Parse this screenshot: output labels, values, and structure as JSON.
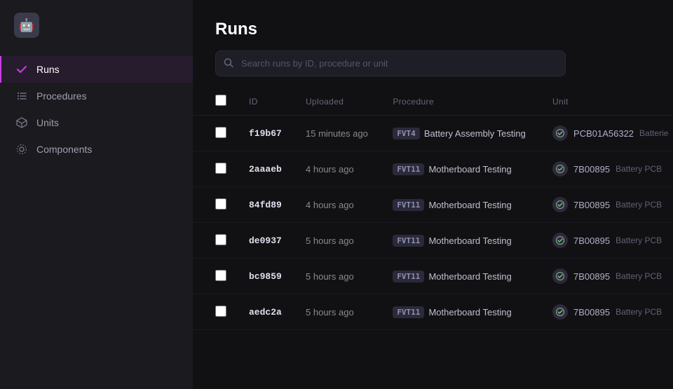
{
  "sidebar": {
    "logo": "🤖",
    "nav_items": [
      {
        "id": "runs",
        "label": "Runs",
        "icon": "check",
        "active": true
      },
      {
        "id": "procedures",
        "label": "Procedures",
        "icon": "list",
        "active": false
      },
      {
        "id": "units",
        "label": "Units",
        "icon": "box",
        "active": false
      },
      {
        "id": "components",
        "label": "Components",
        "icon": "component",
        "active": false
      }
    ]
  },
  "page": {
    "title": "Runs",
    "search_placeholder": "Search runs by ID, procedure or unit"
  },
  "table": {
    "columns": [
      "",
      "ID",
      "Uploaded",
      "Procedure",
      "Unit"
    ],
    "rows": [
      {
        "id": "f19b67",
        "uploaded": "15 minutes ago",
        "proc_tag": "FVT4",
        "proc_name": "Battery Assembly Testing",
        "unit_id": "PCB01A56322",
        "unit_type": "Batterie"
      },
      {
        "id": "2aaaeb",
        "uploaded": "4 hours ago",
        "proc_tag": "FVT11",
        "proc_name": "Motherboard Testing",
        "unit_id": "7B00895",
        "unit_type": "Battery PCB"
      },
      {
        "id": "84fd89",
        "uploaded": "4 hours ago",
        "proc_tag": "FVT11",
        "proc_name": "Motherboard Testing",
        "unit_id": "7B00895",
        "unit_type": "Battery PCB"
      },
      {
        "id": "de0937",
        "uploaded": "5 hours ago",
        "proc_tag": "FVT11",
        "proc_name": "Motherboard Testing",
        "unit_id": "7B00895",
        "unit_type": "Battery PCB"
      },
      {
        "id": "bc9859",
        "uploaded": "5 hours ago",
        "proc_tag": "FVT11",
        "proc_name": "Motherboard Testing",
        "unit_id": "7B00895",
        "unit_type": "Battery PCB"
      },
      {
        "id": "aedc2a",
        "uploaded": "5 hours ago",
        "proc_tag": "FVT11",
        "proc_name": "Motherboard Testing",
        "unit_id": "7B00895",
        "unit_type": "Battery PCB"
      }
    ]
  }
}
